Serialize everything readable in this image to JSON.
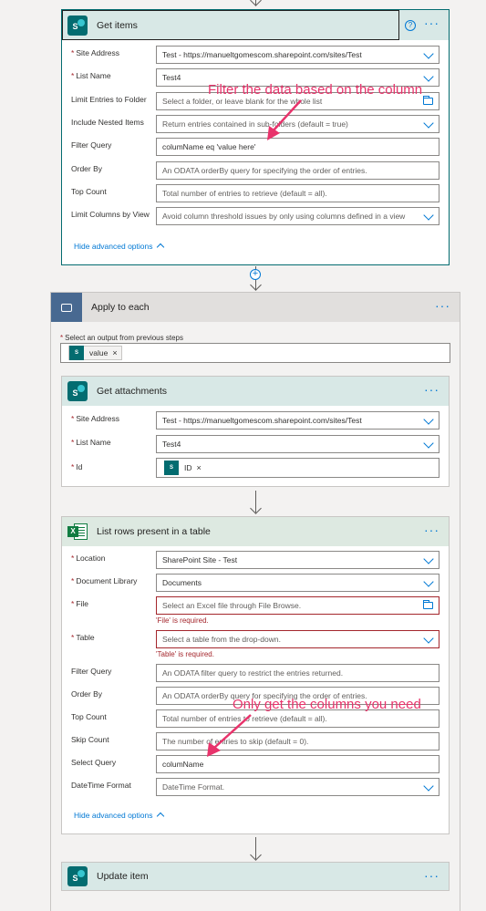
{
  "get_items": {
    "title": "Get items",
    "more": "···",
    "help": "?",
    "icon_letter": "S",
    "fields": [
      {
        "label": "Site Address",
        "required": true,
        "value": "Test - https://manueltgomescom.sharepoint.com/sites/Test",
        "placeholder": false,
        "control": "dropdown"
      },
      {
        "label": "List Name",
        "required": true,
        "value": "Test4",
        "placeholder": false,
        "control": "dropdown"
      },
      {
        "label": "Limit Entries to Folder",
        "required": false,
        "value": "Select a folder, or leave blank for the whole list",
        "placeholder": true,
        "control": "folder"
      },
      {
        "label": "Include Nested Items",
        "required": false,
        "value": "Return entries contained in sub-folders (default = true)",
        "placeholder": true,
        "control": "dropdown"
      },
      {
        "label": "Filter Query",
        "required": false,
        "value": "columName eq 'value here'",
        "placeholder": false,
        "control": "text"
      },
      {
        "label": "Order By",
        "required": false,
        "value": "An ODATA orderBy query for specifying the order of entries.",
        "placeholder": true,
        "control": "text"
      },
      {
        "label": "Top Count",
        "required": false,
        "value": "Total number of entries to retrieve (default = all).",
        "placeholder": true,
        "control": "text"
      },
      {
        "label": "Limit Columns by View",
        "required": false,
        "value": "Avoid column threshold issues by only using columns defined in a view",
        "placeholder": true,
        "control": "dropdown"
      }
    ],
    "hide_advanced": "Hide advanced options"
  },
  "annotation_1": "Filter the data based on the column",
  "annotation_2": "Only get the columns you need",
  "apply_to_each": {
    "title": "Apply to each",
    "more": "···",
    "select_label": "Select an output from previous steps",
    "token": "value",
    "token_close": "×"
  },
  "get_attachments": {
    "title": "Get attachments",
    "more": "···",
    "icon_letter": "S",
    "fields": [
      {
        "label": "Site Address",
        "required": true,
        "value": "Test - https://manueltgomescom.sharepoint.com/sites/Test"
      },
      {
        "label": "List Name",
        "required": true,
        "value": "Test4"
      },
      {
        "label": "Id",
        "required": true,
        "token": "ID",
        "token_close": "×"
      }
    ]
  },
  "list_rows": {
    "title": "List rows present in a table",
    "more": "···",
    "icon_letter": "X",
    "fields": [
      {
        "label": "Location",
        "required": true,
        "value": "SharePoint Site - Test",
        "placeholder": false,
        "control": "dropdown"
      },
      {
        "label": "Document Library",
        "required": true,
        "value": "Documents",
        "placeholder": false,
        "control": "dropdown"
      },
      {
        "label": "File",
        "required": true,
        "value": "Select an Excel file through File Browse.",
        "placeholder": true,
        "control": "folder",
        "error": "'File' is required."
      },
      {
        "label": "Table",
        "required": true,
        "value": "Select a table from the drop-down.",
        "placeholder": true,
        "control": "dropdown",
        "error": "'Table' is required."
      },
      {
        "label": "Filter Query",
        "required": false,
        "value": "An ODATA filter query to restrict the entries returned.",
        "placeholder": true,
        "control": "text"
      },
      {
        "label": "Order By",
        "required": false,
        "value": "An ODATA orderBy query for specifying the order of entries.",
        "placeholder": true,
        "control": "text"
      },
      {
        "label": "Top Count",
        "required": false,
        "value": "Total number of entries to retrieve (default = all).",
        "placeholder": true,
        "control": "text"
      },
      {
        "label": "Skip Count",
        "required": false,
        "value": "The number of entries to skip (default = 0).",
        "placeholder": true,
        "control": "text"
      },
      {
        "label": "Select Query",
        "required": false,
        "value": "columName",
        "placeholder": false,
        "control": "text"
      },
      {
        "label": "DateTime Format",
        "required": false,
        "value": "DateTime Format.",
        "placeholder": true,
        "control": "dropdown"
      }
    ],
    "hide_advanced": "Hide advanced options"
  },
  "update_item": {
    "title": "Update item",
    "more": "···",
    "icon_letter": "S"
  },
  "colors": {
    "sharepoint": "#036c70",
    "excel": "#107c41",
    "loop": "#486991",
    "header_bg": "#d8e8e6",
    "accent": "#0078d4",
    "error": "#a4262c",
    "annotation": "#e8336b"
  }
}
